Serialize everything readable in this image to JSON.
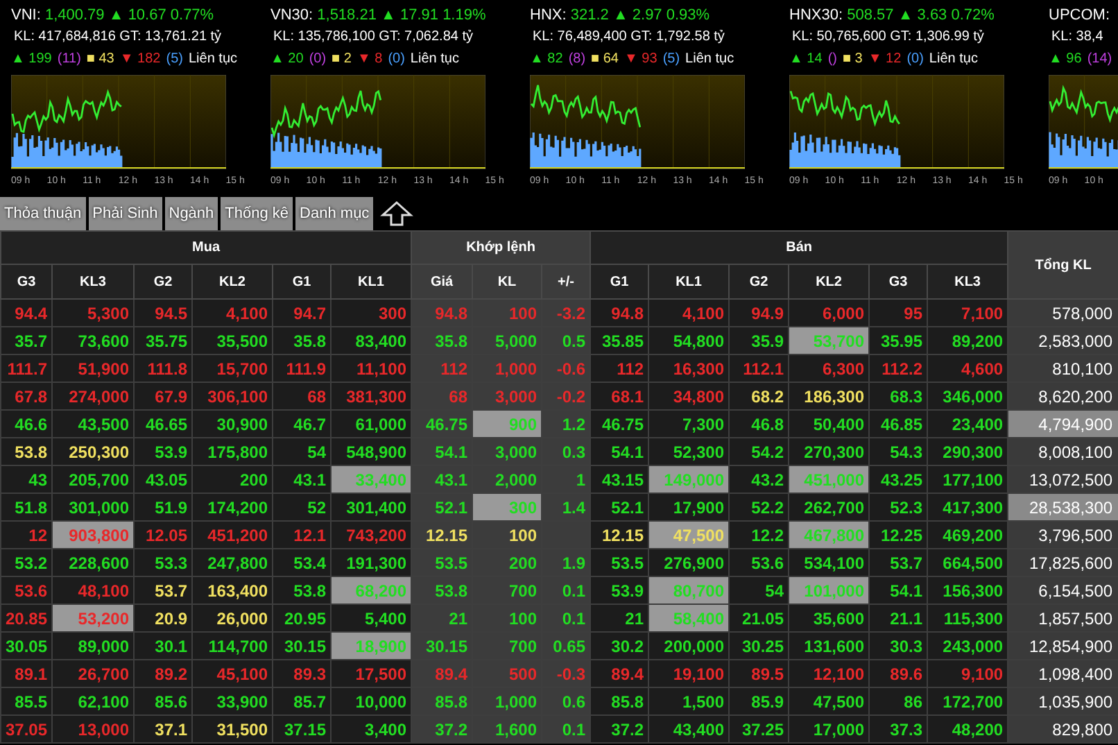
{
  "indices": [
    {
      "name": "VNI:",
      "value": "1,400.79",
      "arrow": "▲",
      "change": "10.67 0.77%",
      "color": "#22dd22",
      "volume": "KL: 417,684,816 GT: 13,761.21 tỷ",
      "breadth": [
        {
          "text": "▲ 199",
          "color": "#22dd22"
        },
        {
          "text": "(11)",
          "color": "#c040e0"
        },
        {
          "text": "■ 43",
          "color": "#f0e060"
        },
        {
          "text": "▼ 182",
          "color": "#e8282a"
        },
        {
          "text": "(5)",
          "color": "#4aa0ff"
        }
      ],
      "status": "Liên tục",
      "time_labels": [
        "09 h",
        "10 h",
        "11 h",
        "12 h",
        "13 h",
        "14 h",
        "15 h"
      ]
    },
    {
      "name": "VN30:",
      "value": "1,518.21",
      "arrow": "▲",
      "change": "17.91 1.19%",
      "color": "#22dd22",
      "volume": "KL: 135,786,100 GT: 7,062.84 tỷ",
      "breadth": [
        {
          "text": "▲ 20",
          "color": "#22dd22"
        },
        {
          "text": "(0)",
          "color": "#c040e0"
        },
        {
          "text": "■ 2",
          "color": "#f0e060"
        },
        {
          "text": "▼ 8",
          "color": "#e8282a"
        },
        {
          "text": "(0)",
          "color": "#4aa0ff"
        }
      ],
      "status": "Liên tục",
      "time_labels": [
        "09 h",
        "10 h",
        "11 h",
        "12 h",
        "13 h",
        "14 h",
        "15 h"
      ]
    },
    {
      "name": "HNX:",
      "value": "321.2",
      "arrow": "▲",
      "change": "2.97 0.93%",
      "color": "#22dd22",
      "volume": "KL: 76,489,400 GT: 1,792.58 tỷ",
      "breadth": [
        {
          "text": "▲ 82",
          "color": "#22dd22"
        },
        {
          "text": "(8)",
          "color": "#c040e0"
        },
        {
          "text": "■ 64",
          "color": "#f0e060"
        },
        {
          "text": "▼ 93",
          "color": "#e8282a"
        },
        {
          "text": "(5)",
          "color": "#4aa0ff"
        }
      ],
      "status": "Liên tục",
      "time_labels": [
        "09 h",
        "10 h",
        "11 h",
        "12 h",
        "13 h",
        "14 h",
        "15 h"
      ]
    },
    {
      "name": "HNX30:",
      "value": "508.57",
      "arrow": "▲",
      "change": "3.63 0.72%",
      "color": "#22dd22",
      "volume": "KL: 50,765,600 GT: 1,306.99 tỷ",
      "breadth": [
        {
          "text": "▲ 14",
          "color": "#22dd22"
        },
        {
          "text": "()",
          "color": "#c040e0"
        },
        {
          "text": "■ 3",
          "color": "#f0e060"
        },
        {
          "text": "▼ 12",
          "color": "#e8282a"
        },
        {
          "text": "(0)",
          "color": "#4aa0ff"
        }
      ],
      "status": "Liên tục",
      "time_labels": [
        "09 h",
        "10 h",
        "11 h",
        "12 h",
        "13 h",
        "14 h",
        "15 h"
      ]
    },
    {
      "name": "UPCOM:",
      "volume": "KL: 38,4",
      "breadth": [
        {
          "text": "▲ 96",
          "color": "#22dd22"
        },
        {
          "text": "(14)",
          "color": "#c040e0"
        }
      ],
      "time_labels": [
        "09 h",
        "10 h"
      ]
    }
  ],
  "tabs": [
    {
      "label": "Thỏa thuận",
      "selected": false
    },
    {
      "label": "Phải Sinh",
      "selected": false
    },
    {
      "label": "Ngành",
      "selected": false
    },
    {
      "label": "Thống kê",
      "selected": false
    },
    {
      "label": "Danh mục",
      "selected": false
    }
  ],
  "table": {
    "groups": [
      "Mua",
      "Khớp lệnh",
      "Bán"
    ],
    "total_heading": "Tổng KL",
    "columns": [
      "G3",
      "KL3",
      "G2",
      "KL2",
      "G1",
      "KL1",
      "Giá",
      "KL",
      "+/-",
      "G1",
      "KL1",
      "G2",
      "KL2",
      "G3",
      "KL3"
    ],
    "rows": [
      {
        "cells": [
          {
            "text": "94.4",
            "color": "#e8282a",
            "highlighted": false
          },
          {
            "text": "5,300",
            "color": "#e8282a",
            "highlighted": false
          },
          {
            "text": "94.5",
            "color": "#e8282a",
            "highlighted": false
          },
          {
            "text": "4,100",
            "color": "#e8282a",
            "highlighted": false
          },
          {
            "text": "94.7",
            "color": "#e8282a",
            "highlighted": false
          },
          {
            "text": "300",
            "color": "#e8282a",
            "highlighted": false
          },
          {
            "text": "94.8",
            "color": "#e8282a",
            "highlighted": false
          },
          {
            "text": "100",
            "color": "#e8282a",
            "highlighted": false
          },
          {
            "text": "-3.2",
            "color": "#e8282a",
            "highlighted": false
          },
          {
            "text": "94.8",
            "color": "#e8282a",
            "highlighted": false
          },
          {
            "text": "4,100",
            "color": "#e8282a",
            "highlighted": false
          },
          {
            "text": "94.9",
            "color": "#e8282a",
            "highlighted": false
          },
          {
            "text": "6,000",
            "color": "#e8282a",
            "highlighted": false
          },
          {
            "text": "95",
            "color": "#e8282a",
            "highlighted": false
          },
          {
            "text": "7,100",
            "color": "#e8282a",
            "highlighted": false
          }
        ],
        "total": {
          "text": "578,000",
          "highlighted": false
        }
      },
      {
        "cells": [
          {
            "text": "35.7",
            "color": "#22dd22",
            "highlighted": false
          },
          {
            "text": "73,600",
            "color": "#22dd22",
            "highlighted": false
          },
          {
            "text": "35.75",
            "color": "#22dd22",
            "highlighted": false
          },
          {
            "text": "35,500",
            "color": "#22dd22",
            "highlighted": false
          },
          {
            "text": "35.8",
            "color": "#22dd22",
            "highlighted": false
          },
          {
            "text": "83,400",
            "color": "#22dd22",
            "highlighted": false
          },
          {
            "text": "35.8",
            "color": "#22dd22",
            "highlighted": false
          },
          {
            "text": "5,000",
            "color": "#22dd22",
            "highlighted": false
          },
          {
            "text": "0.5",
            "color": "#22dd22",
            "highlighted": false
          },
          {
            "text": "35.85",
            "color": "#22dd22",
            "highlighted": false
          },
          {
            "text": "54,800",
            "color": "#22dd22",
            "highlighted": false
          },
          {
            "text": "35.9",
            "color": "#22dd22",
            "highlighted": false
          },
          {
            "text": "53,700",
            "color": "#22dd22",
            "highlighted": true
          },
          {
            "text": "35.95",
            "color": "#22dd22",
            "highlighted": false
          },
          {
            "text": "89,200",
            "color": "#22dd22",
            "highlighted": false
          }
        ],
        "total": {
          "text": "2,583,000",
          "highlighted": false
        }
      },
      {
        "cells": [
          {
            "text": "111.7",
            "color": "#e8282a",
            "highlighted": false
          },
          {
            "text": "51,900",
            "color": "#e8282a",
            "highlighted": false
          },
          {
            "text": "111.8",
            "color": "#e8282a",
            "highlighted": false
          },
          {
            "text": "15,700",
            "color": "#e8282a",
            "highlighted": false
          },
          {
            "text": "111.9",
            "color": "#e8282a",
            "highlighted": false
          },
          {
            "text": "11,100",
            "color": "#e8282a",
            "highlighted": false
          },
          {
            "text": "112",
            "color": "#e8282a",
            "highlighted": false
          },
          {
            "text": "1,000",
            "color": "#e8282a",
            "highlighted": false
          },
          {
            "text": "-0.6",
            "color": "#e8282a",
            "highlighted": false
          },
          {
            "text": "112",
            "color": "#e8282a",
            "highlighted": false
          },
          {
            "text": "16,300",
            "color": "#e8282a",
            "highlighted": false
          },
          {
            "text": "112.1",
            "color": "#e8282a",
            "highlighted": false
          },
          {
            "text": "6,300",
            "color": "#e8282a",
            "highlighted": false
          },
          {
            "text": "112.2",
            "color": "#e8282a",
            "highlighted": false
          },
          {
            "text": "4,600",
            "color": "#e8282a",
            "highlighted": false
          }
        ],
        "total": {
          "text": "810,100",
          "highlighted": false
        }
      },
      {
        "cells": [
          {
            "text": "67.8",
            "color": "#e8282a",
            "highlighted": false
          },
          {
            "text": "274,000",
            "color": "#e8282a",
            "highlighted": false
          },
          {
            "text": "67.9",
            "color": "#e8282a",
            "highlighted": false
          },
          {
            "text": "306,100",
            "color": "#e8282a",
            "highlighted": false
          },
          {
            "text": "68",
            "color": "#e8282a",
            "highlighted": false
          },
          {
            "text": "381,300",
            "color": "#e8282a",
            "highlighted": false
          },
          {
            "text": "68",
            "color": "#e8282a",
            "highlighted": false
          },
          {
            "text": "3,000",
            "color": "#e8282a",
            "highlighted": false
          },
          {
            "text": "-0.2",
            "color": "#e8282a",
            "highlighted": false
          },
          {
            "text": "68.1",
            "color": "#e8282a",
            "highlighted": false
          },
          {
            "text": "34,800",
            "color": "#e8282a",
            "highlighted": false
          },
          {
            "text": "68.2",
            "color": "#f0e060",
            "highlighted": false
          },
          {
            "text": "186,300",
            "color": "#f0e060",
            "highlighted": false
          },
          {
            "text": "68.3",
            "color": "#22dd22",
            "highlighted": false
          },
          {
            "text": "346,000",
            "color": "#22dd22",
            "highlighted": false
          }
        ],
        "total": {
          "text": "8,620,200",
          "highlighted": false
        }
      },
      {
        "cells": [
          {
            "text": "46.6",
            "color": "#22dd22",
            "highlighted": false
          },
          {
            "text": "43,500",
            "color": "#22dd22",
            "highlighted": false
          },
          {
            "text": "46.65",
            "color": "#22dd22",
            "highlighted": false
          },
          {
            "text": "30,900",
            "color": "#22dd22",
            "highlighted": false
          },
          {
            "text": "46.7",
            "color": "#22dd22",
            "highlighted": false
          },
          {
            "text": "61,000",
            "color": "#22dd22",
            "highlighted": false
          },
          {
            "text": "46.75",
            "color": "#22dd22",
            "highlighted": false
          },
          {
            "text": "900",
            "color": "#22dd22",
            "highlighted": true
          },
          {
            "text": "1.2",
            "color": "#22dd22",
            "highlighted": false
          },
          {
            "text": "46.75",
            "color": "#22dd22",
            "highlighted": false
          },
          {
            "text": "7,300",
            "color": "#22dd22",
            "highlighted": false
          },
          {
            "text": "46.8",
            "color": "#22dd22",
            "highlighted": false
          },
          {
            "text": "50,400",
            "color": "#22dd22",
            "highlighted": false
          },
          {
            "text": "46.85",
            "color": "#22dd22",
            "highlighted": false
          },
          {
            "text": "23,400",
            "color": "#22dd22",
            "highlighted": false
          }
        ],
        "total": {
          "text": "4,794,900",
          "highlighted": true
        }
      },
      {
        "cells": [
          {
            "text": "53.8",
            "color": "#f0e060",
            "highlighted": false
          },
          {
            "text": "250,300",
            "color": "#f0e060",
            "highlighted": false
          },
          {
            "text": "53.9",
            "color": "#22dd22",
            "highlighted": false
          },
          {
            "text": "175,800",
            "color": "#22dd22",
            "highlighted": false
          },
          {
            "text": "54",
            "color": "#22dd22",
            "highlighted": false
          },
          {
            "text": "548,900",
            "color": "#22dd22",
            "highlighted": false
          },
          {
            "text": "54.1",
            "color": "#22dd22",
            "highlighted": false
          },
          {
            "text": "3,000",
            "color": "#22dd22",
            "highlighted": false
          },
          {
            "text": "0.3",
            "color": "#22dd22",
            "highlighted": false
          },
          {
            "text": "54.1",
            "color": "#22dd22",
            "highlighted": false
          },
          {
            "text": "52,300",
            "color": "#22dd22",
            "highlighted": false
          },
          {
            "text": "54.2",
            "color": "#22dd22",
            "highlighted": false
          },
          {
            "text": "270,300",
            "color": "#22dd22",
            "highlighted": false
          },
          {
            "text": "54.3",
            "color": "#22dd22",
            "highlighted": false
          },
          {
            "text": "290,300",
            "color": "#22dd22",
            "highlighted": false
          }
        ],
        "total": {
          "text": "8,008,100",
          "highlighted": false
        }
      },
      {
        "cells": [
          {
            "text": "43",
            "color": "#22dd22",
            "highlighted": false
          },
          {
            "text": "205,700",
            "color": "#22dd22",
            "highlighted": false
          },
          {
            "text": "43.05",
            "color": "#22dd22",
            "highlighted": false
          },
          {
            "text": "200",
            "color": "#22dd22",
            "highlighted": false
          },
          {
            "text": "43.1",
            "color": "#22dd22",
            "highlighted": false
          },
          {
            "text": "33,400",
            "color": "#22dd22",
            "highlighted": true
          },
          {
            "text": "43.1",
            "color": "#22dd22",
            "highlighted": false
          },
          {
            "text": "2,000",
            "color": "#22dd22",
            "highlighted": false
          },
          {
            "text": "1",
            "color": "#22dd22",
            "highlighted": false
          },
          {
            "text": "43.15",
            "color": "#22dd22",
            "highlighted": false
          },
          {
            "text": "149,000",
            "color": "#22dd22",
            "highlighted": true
          },
          {
            "text": "43.2",
            "color": "#22dd22",
            "highlighted": false
          },
          {
            "text": "451,000",
            "color": "#22dd22",
            "highlighted": true
          },
          {
            "text": "43.25",
            "color": "#22dd22",
            "highlighted": false
          },
          {
            "text": "177,100",
            "color": "#22dd22",
            "highlighted": false
          }
        ],
        "total": {
          "text": "13,072,500",
          "highlighted": false
        }
      },
      {
        "cells": [
          {
            "text": "51.8",
            "color": "#22dd22",
            "highlighted": false
          },
          {
            "text": "301,000",
            "color": "#22dd22",
            "highlighted": false
          },
          {
            "text": "51.9",
            "color": "#22dd22",
            "highlighted": false
          },
          {
            "text": "174,200",
            "color": "#22dd22",
            "highlighted": false
          },
          {
            "text": "52",
            "color": "#22dd22",
            "highlighted": false
          },
          {
            "text": "301,400",
            "color": "#22dd22",
            "highlighted": false
          },
          {
            "text": "52.1",
            "color": "#22dd22",
            "highlighted": false
          },
          {
            "text": "300",
            "color": "#22dd22",
            "highlighted": true
          },
          {
            "text": "1.4",
            "color": "#22dd22",
            "highlighted": false
          },
          {
            "text": "52.1",
            "color": "#22dd22",
            "highlighted": false
          },
          {
            "text": "17,900",
            "color": "#22dd22",
            "highlighted": false
          },
          {
            "text": "52.2",
            "color": "#22dd22",
            "highlighted": false
          },
          {
            "text": "262,700",
            "color": "#22dd22",
            "highlighted": false
          },
          {
            "text": "52.3",
            "color": "#22dd22",
            "highlighted": false
          },
          {
            "text": "417,300",
            "color": "#22dd22",
            "highlighted": false
          }
        ],
        "total": {
          "text": "28,538,300",
          "highlighted": true
        }
      },
      {
        "cells": [
          {
            "text": "12",
            "color": "#e8282a",
            "highlighted": false
          },
          {
            "text": "903,800",
            "color": "#e8282a",
            "highlighted": true
          },
          {
            "text": "12.05",
            "color": "#e8282a",
            "highlighted": false
          },
          {
            "text": "451,200",
            "color": "#e8282a",
            "highlighted": false
          },
          {
            "text": "12.1",
            "color": "#e8282a",
            "highlighted": false
          },
          {
            "text": "743,200",
            "color": "#e8282a",
            "highlighted": false
          },
          {
            "text": "12.15",
            "color": "#f0e060",
            "highlighted": false
          },
          {
            "text": "100",
            "color": "#f0e060",
            "highlighted": false
          },
          {
            "highlighted": false
          },
          {
            "text": "12.15",
            "color": "#f0e060",
            "highlighted": false
          },
          {
            "text": "47,500",
            "color": "#f0e060",
            "highlighted": true
          },
          {
            "text": "12.2",
            "color": "#22dd22",
            "highlighted": false
          },
          {
            "text": "467,800",
            "color": "#22dd22",
            "highlighted": true
          },
          {
            "text": "12.25",
            "color": "#22dd22",
            "highlighted": false
          },
          {
            "text": "469,200",
            "color": "#22dd22",
            "highlighted": false
          }
        ],
        "total": {
          "text": "3,796,500",
          "highlighted": false
        }
      },
      {
        "cells": [
          {
            "text": "53.2",
            "color": "#22dd22",
            "highlighted": false
          },
          {
            "text": "228,600",
            "color": "#22dd22",
            "highlighted": false
          },
          {
            "text": "53.3",
            "color": "#22dd22",
            "highlighted": false
          },
          {
            "text": "247,800",
            "color": "#22dd22",
            "highlighted": false
          },
          {
            "text": "53.4",
            "color": "#22dd22",
            "highlighted": false
          },
          {
            "text": "191,300",
            "color": "#22dd22",
            "highlighted": false
          },
          {
            "text": "53.5",
            "color": "#22dd22",
            "highlighted": false
          },
          {
            "text": "200",
            "color": "#22dd22",
            "highlighted": false
          },
          {
            "text": "1.9",
            "color": "#22dd22",
            "highlighted": false
          },
          {
            "text": "53.5",
            "color": "#22dd22",
            "highlighted": false
          },
          {
            "text": "276,900",
            "color": "#22dd22",
            "highlighted": false
          },
          {
            "text": "53.6",
            "color": "#22dd22",
            "highlighted": false
          },
          {
            "text": "534,100",
            "color": "#22dd22",
            "highlighted": false
          },
          {
            "text": "53.7",
            "color": "#22dd22",
            "highlighted": false
          },
          {
            "text": "664,500",
            "color": "#22dd22",
            "highlighted": false
          }
        ],
        "total": {
          "text": "17,825,600",
          "highlighted": false
        }
      },
      {
        "cells": [
          {
            "text": "53.6",
            "color": "#e8282a",
            "highlighted": false
          },
          {
            "text": "48,100",
            "color": "#e8282a",
            "highlighted": false
          },
          {
            "text": "53.7",
            "color": "#f0e060",
            "highlighted": false
          },
          {
            "text": "163,400",
            "color": "#f0e060",
            "highlighted": false
          },
          {
            "text": "53.8",
            "color": "#22dd22",
            "highlighted": false
          },
          {
            "text": "68,200",
            "color": "#22dd22",
            "highlighted": true
          },
          {
            "text": "53.8",
            "color": "#22dd22",
            "highlighted": false
          },
          {
            "text": "700",
            "color": "#22dd22",
            "highlighted": false
          },
          {
            "text": "0.1",
            "color": "#22dd22",
            "highlighted": false
          },
          {
            "text": "53.9",
            "color": "#22dd22",
            "highlighted": false
          },
          {
            "text": "80,700",
            "color": "#22dd22",
            "highlighted": true
          },
          {
            "text": "54",
            "color": "#22dd22",
            "highlighted": false
          },
          {
            "text": "101,000",
            "color": "#22dd22",
            "highlighted": true
          },
          {
            "text": "54.1",
            "color": "#22dd22",
            "highlighted": false
          },
          {
            "text": "156,300",
            "color": "#22dd22",
            "highlighted": false
          }
        ],
        "total": {
          "text": "6,154,500",
          "highlighted": false
        }
      },
      {
        "cells": [
          {
            "text": "20.85",
            "color": "#e8282a",
            "highlighted": false
          },
          {
            "text": "53,200",
            "color": "#e8282a",
            "highlighted": true
          },
          {
            "text": "20.9",
            "color": "#f0e060",
            "highlighted": false
          },
          {
            "text": "26,000",
            "color": "#f0e060",
            "highlighted": false
          },
          {
            "text": "20.95",
            "color": "#22dd22",
            "highlighted": false
          },
          {
            "text": "5,400",
            "color": "#22dd22",
            "highlighted": false
          },
          {
            "text": "21",
            "color": "#22dd22",
            "highlighted": false
          },
          {
            "text": "100",
            "color": "#22dd22",
            "highlighted": false
          },
          {
            "text": "0.1",
            "color": "#22dd22",
            "highlighted": false
          },
          {
            "text": "21",
            "color": "#22dd22",
            "highlighted": false
          },
          {
            "text": "58,400",
            "color": "#22dd22",
            "highlighted": true
          },
          {
            "text": "21.05",
            "color": "#22dd22",
            "highlighted": false
          },
          {
            "text": "35,600",
            "color": "#22dd22",
            "highlighted": false
          },
          {
            "text": "21.1",
            "color": "#22dd22",
            "highlighted": false
          },
          {
            "text": "115,300",
            "color": "#22dd22",
            "highlighted": false
          }
        ],
        "total": {
          "text": "1,857,500",
          "highlighted": false
        }
      },
      {
        "cells": [
          {
            "text": "30.05",
            "color": "#22dd22",
            "highlighted": false
          },
          {
            "text": "89,000",
            "color": "#22dd22",
            "highlighted": false
          },
          {
            "text": "30.1",
            "color": "#22dd22",
            "highlighted": false
          },
          {
            "text": "114,700",
            "color": "#22dd22",
            "highlighted": false
          },
          {
            "text": "30.15",
            "color": "#22dd22",
            "highlighted": false
          },
          {
            "text": "18,900",
            "color": "#22dd22",
            "highlighted": true
          },
          {
            "text": "30.15",
            "color": "#22dd22",
            "highlighted": false
          },
          {
            "text": "700",
            "color": "#22dd22",
            "highlighted": false
          },
          {
            "text": "0.65",
            "color": "#22dd22",
            "highlighted": false
          },
          {
            "text": "30.2",
            "color": "#22dd22",
            "highlighted": false
          },
          {
            "text": "200,000",
            "color": "#22dd22",
            "highlighted": false
          },
          {
            "text": "30.25",
            "color": "#22dd22",
            "highlighted": false
          },
          {
            "text": "131,600",
            "color": "#22dd22",
            "highlighted": false
          },
          {
            "text": "30.3",
            "color": "#22dd22",
            "highlighted": false
          },
          {
            "text": "243,000",
            "color": "#22dd22",
            "highlighted": false
          }
        ],
        "total": {
          "text": "12,854,900",
          "highlighted": false
        }
      },
      {
        "cells": [
          {
            "text": "89.1",
            "color": "#e8282a",
            "highlighted": false
          },
          {
            "text": "26,700",
            "color": "#e8282a",
            "highlighted": false
          },
          {
            "text": "89.2",
            "color": "#e8282a",
            "highlighted": false
          },
          {
            "text": "45,100",
            "color": "#e8282a",
            "highlighted": false
          },
          {
            "text": "89.3",
            "color": "#e8282a",
            "highlighted": false
          },
          {
            "text": "17,500",
            "color": "#e8282a",
            "highlighted": false
          },
          {
            "text": "89.4",
            "color": "#e8282a",
            "highlighted": false
          },
          {
            "text": "500",
            "color": "#e8282a",
            "highlighted": false
          },
          {
            "text": "-0.3",
            "color": "#e8282a",
            "highlighted": false
          },
          {
            "text": "89.4",
            "color": "#e8282a",
            "highlighted": false
          },
          {
            "text": "19,100",
            "color": "#e8282a",
            "highlighted": false
          },
          {
            "text": "89.5",
            "color": "#e8282a",
            "highlighted": false
          },
          {
            "text": "12,100",
            "color": "#e8282a",
            "highlighted": false
          },
          {
            "text": "89.6",
            "color": "#e8282a",
            "highlighted": false
          },
          {
            "text": "9,100",
            "color": "#e8282a",
            "highlighted": false
          }
        ],
        "total": {
          "text": "1,098,400",
          "highlighted": false
        }
      },
      {
        "cells": [
          {
            "text": "85.5",
            "color": "#22dd22",
            "highlighted": false
          },
          {
            "text": "62,100",
            "color": "#22dd22",
            "highlighted": false
          },
          {
            "text": "85.6",
            "color": "#22dd22",
            "highlighted": false
          },
          {
            "text": "33,900",
            "color": "#22dd22",
            "highlighted": false
          },
          {
            "text": "85.7",
            "color": "#22dd22",
            "highlighted": false
          },
          {
            "text": "10,000",
            "color": "#22dd22",
            "highlighted": false
          },
          {
            "text": "85.8",
            "color": "#22dd22",
            "highlighted": false
          },
          {
            "text": "1,000",
            "color": "#22dd22",
            "highlighted": false
          },
          {
            "text": "0.6",
            "color": "#22dd22",
            "highlighted": false
          },
          {
            "text": "85.8",
            "color": "#22dd22",
            "highlighted": false
          },
          {
            "text": "1,500",
            "color": "#22dd22",
            "highlighted": false
          },
          {
            "text": "85.9",
            "color": "#22dd22",
            "highlighted": false
          },
          {
            "text": "47,500",
            "color": "#22dd22",
            "highlighted": false
          },
          {
            "text": "86",
            "color": "#22dd22",
            "highlighted": false
          },
          {
            "text": "172,700",
            "color": "#22dd22",
            "highlighted": false
          }
        ],
        "total": {
          "text": "1,035,900",
          "highlighted": false
        }
      },
      {
        "cells": [
          {
            "text": "37.05",
            "color": "#e8282a",
            "highlighted": false
          },
          {
            "text": "13,000",
            "color": "#e8282a",
            "highlighted": false
          },
          {
            "text": "37.1",
            "color": "#f0e060",
            "highlighted": false
          },
          {
            "text": "31,500",
            "color": "#f0e060",
            "highlighted": false
          },
          {
            "text": "37.15",
            "color": "#22dd22",
            "highlighted": false
          },
          {
            "text": "3,400",
            "color": "#22dd22",
            "highlighted": false
          },
          {
            "text": "37.2",
            "color": "#22dd22",
            "highlighted": false
          },
          {
            "text": "1,600",
            "color": "#22dd22",
            "highlighted": false
          },
          {
            "text": "0.1",
            "color": "#22dd22",
            "highlighted": false
          },
          {
            "text": "37.2",
            "color": "#22dd22",
            "highlighted": false
          },
          {
            "text": "43,400",
            "color": "#22dd22",
            "highlighted": false
          },
          {
            "text": "37.25",
            "color": "#22dd22",
            "highlighted": false
          },
          {
            "text": "17,000",
            "color": "#22dd22",
            "highlighted": false
          },
          {
            "text": "37.3",
            "color": "#22dd22",
            "highlighted": false
          },
          {
            "text": "48,200",
            "color": "#22dd22",
            "highlighted": false
          }
        ],
        "total": {
          "text": "829,800",
          "highlighted": false
        }
      }
    ]
  }
}
